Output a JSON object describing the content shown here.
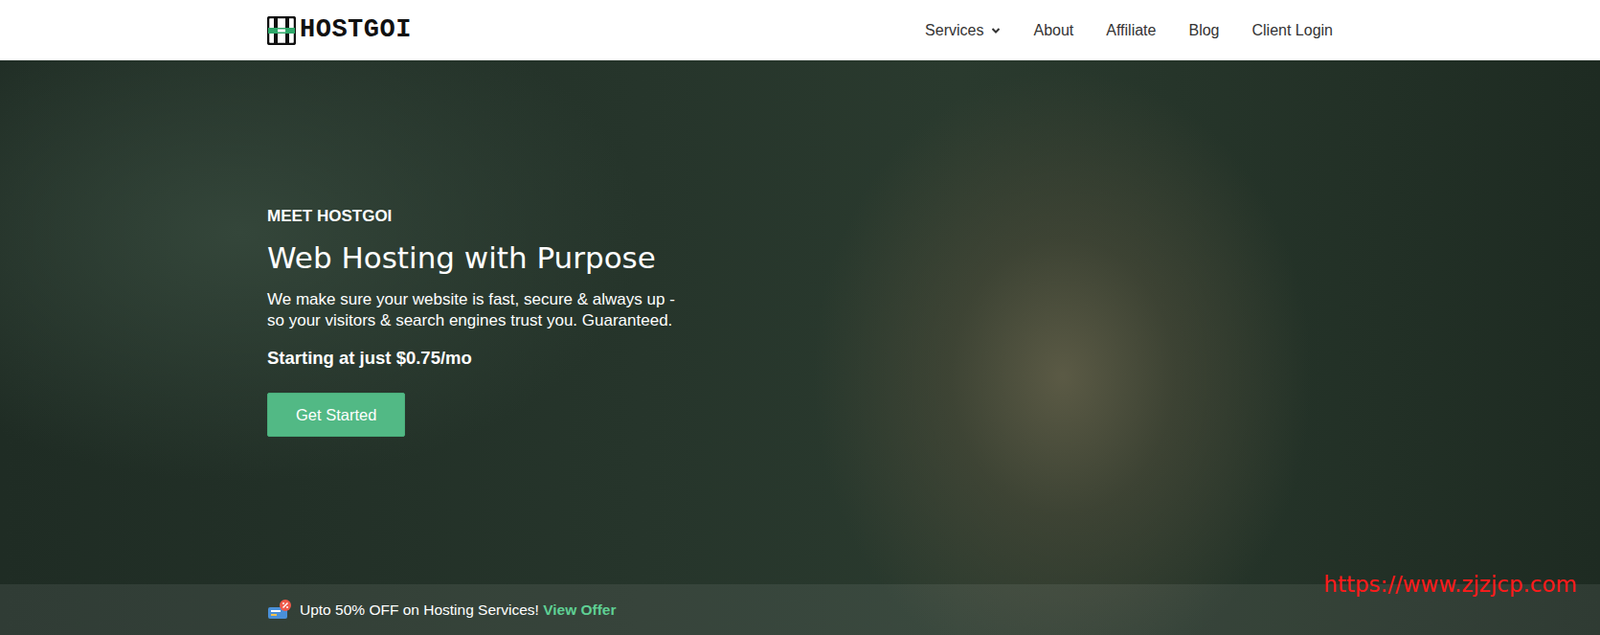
{
  "logo": {
    "text": "HOSTGOI"
  },
  "nav": {
    "items": [
      {
        "label": "Services",
        "kind": "dropdown"
      },
      {
        "label": "About",
        "kind": "link"
      },
      {
        "label": "Affiliate",
        "kind": "link"
      },
      {
        "label": "Blog",
        "kind": "link"
      },
      {
        "label": "Client Login",
        "kind": "link"
      }
    ]
  },
  "hero": {
    "eyebrow": "MEET HOSTGOI",
    "title": "Web Hosting with Purpose",
    "description_lines": [
      "We make sure your website is fast, secure & always up -",
      "so your visitors & search engines trust you. Guaranteed."
    ],
    "price": "Starting at just $0.75/mo",
    "button": "Get Started"
  },
  "offer_bar": {
    "text": "Upto 50% OFF on Hosting Services!",
    "link": "View Offer"
  },
  "watermark": "https://www.zjzjcp.com"
}
